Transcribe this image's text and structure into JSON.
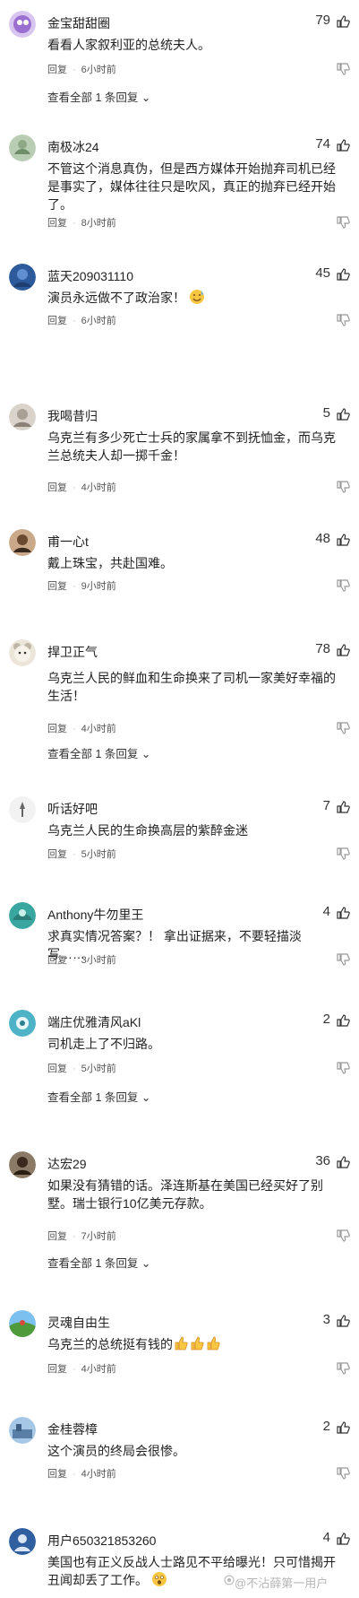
{
  "labels": {
    "reply": "回复",
    "sep": "·"
  },
  "comments": [
    {
      "user": "金宝甜甜圈",
      "likes": "79",
      "text": "看看人家叙利亚的总统夫人。",
      "time": "6小时前",
      "replies_text": "查看全部 1 条回复",
      "avatar_color": "#b58fd9"
    },
    {
      "user": "南极冰24",
      "likes": "74",
      "text": "不管这个消息真伪，但是西方媒体开始抛弃司机已经是事实了，媒体往往只是吹风，真正的抛弃已经开始了。",
      "time": "8小时前",
      "avatar_color": "#9fb89a"
    },
    {
      "user": "蓝天209031110",
      "likes": "45",
      "text": "演员永远做不了政治家！",
      "time": "6小时前",
      "avatar_color": "#3f6fb0"
    },
    {
      "user": "我喝昔归",
      "likes": "5",
      "text": "乌克兰有多少死亡士兵的家属拿不到抚恤金，而乌克兰总统夫人却一掷千金！",
      "time": "4小时前",
      "avatar_color": "#b9b2aa"
    },
    {
      "user": "甫一心t",
      "likes": "48",
      "text": "戴上珠宝，共赴国难。",
      "time": "9小时前",
      "avatar_color": "#8a6a4f"
    },
    {
      "user": "捍卫正气",
      "likes": "78",
      "text": "乌克兰人民的鲜血和生命换来了司机一家美好幸福的生活！",
      "time": "4小时前",
      "replies_text": "查看全部 1 条回复",
      "avatar_color": "#d8d0c0"
    },
    {
      "user": "听话好吧",
      "likes": "7",
      "text": "乌克兰人民的生命换高层的紫醉金迷",
      "time": "5小时前",
      "avatar_color": "#e8e8e8"
    },
    {
      "user": "Anthony牛勿里王",
      "likes": "4",
      "text": "求真实情况答案？！ 拿出证据来，不要轻描淡写……",
      "time": "3小时前",
      "avatar_color": "#3aa6a0"
    },
    {
      "user": "端庄优雅清风aKl",
      "likes": "2",
      "text": "司机走上了不归路。",
      "time": "5小时前",
      "replies_text": "查看全部 1 条回复",
      "avatar_color": "#4fb3c8"
    },
    {
      "user": "达宏29",
      "likes": "36",
      "text": "如果没有猜错的话。泽连斯基在美国已经买好了别墅。瑞士银行10亿美元存款。",
      "time": "7小时前",
      "replies_text": "查看全部 1 条回复",
      "avatar_color": "#5a4a3a"
    },
    {
      "user": "灵魂自由生",
      "likes": "3",
      "text": "乌克兰的总统挺有钱的",
      "time": "4小时前",
      "avatar_color": "#5aa04a"
    },
    {
      "user": "金桂蓉樟",
      "likes": "2",
      "text": "这个演员的终局会很惨。",
      "time": "4小时前",
      "avatar_color": "#7a9fbf"
    },
    {
      "user": "用户650321853260",
      "likes": "4",
      "text": "美国也有正义反战人士路见不平给曝光！只可惜揭开丑闻却丢了工作。",
      "avatar_color": "#2f5f9f"
    }
  ],
  "watermark": "@不沾薛第一用户"
}
